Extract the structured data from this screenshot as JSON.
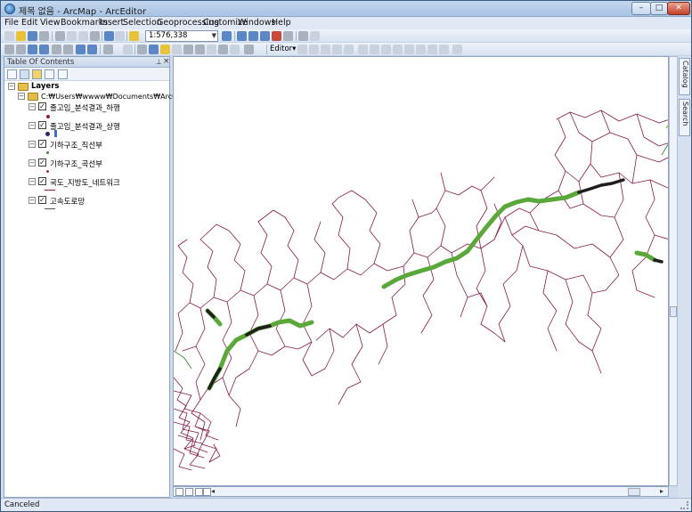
{
  "window": {
    "title": "제목 없음 - ArcMap - ArcEditor",
    "minimize": "–",
    "maximize": "□",
    "close": "✕"
  },
  "menu": [
    "File",
    "Edit",
    "View",
    "Bookmarks",
    "Insert",
    "Selection",
    "Geoprocessing",
    "Customize",
    "Windows",
    "Help"
  ],
  "toolbar": {
    "scale": "1:576,338",
    "editor_label": "Editor▾"
  },
  "toc": {
    "title": "Table Of Contents",
    "pin": "⊥",
    "close": "×",
    "layers_label": "Layers",
    "path_label": "C:₩Users₩wwww₩Documents₩ArcGIS₩졸고임",
    "layers": [
      {
        "name": "졸고임_분석결과_하행",
        "checked": true,
        "symbol": "point",
        "color": "#8c1d50"
      },
      {
        "name": "졸고임_분석결과_상행",
        "checked": true,
        "symbol": "point-bar",
        "color": "#27285f"
      },
      {
        "name": "기하구조_직선부",
        "checked": true,
        "symbol": "point",
        "color": "#3c8a3a"
      },
      {
        "name": "기하구조_곡선부",
        "checked": true,
        "symbol": "point",
        "color": "#a52a5c"
      },
      {
        "name": "국도_지방도_네트워크",
        "checked": true,
        "symbol": "line",
        "color": "#7a1a45"
      },
      {
        "name": "고속도로망",
        "checked": true,
        "symbol": "line",
        "color": "#555555"
      }
    ]
  },
  "sidetabs": {
    "catalog": "Catalog",
    "search": "Search"
  },
  "status": {
    "text": "Canceled"
  },
  "colors": {
    "road_network": "#8a1848",
    "highway_green": "#5aa83a",
    "highway_dark": "#1e1e1e",
    "accent_green": "#7fd13b"
  }
}
